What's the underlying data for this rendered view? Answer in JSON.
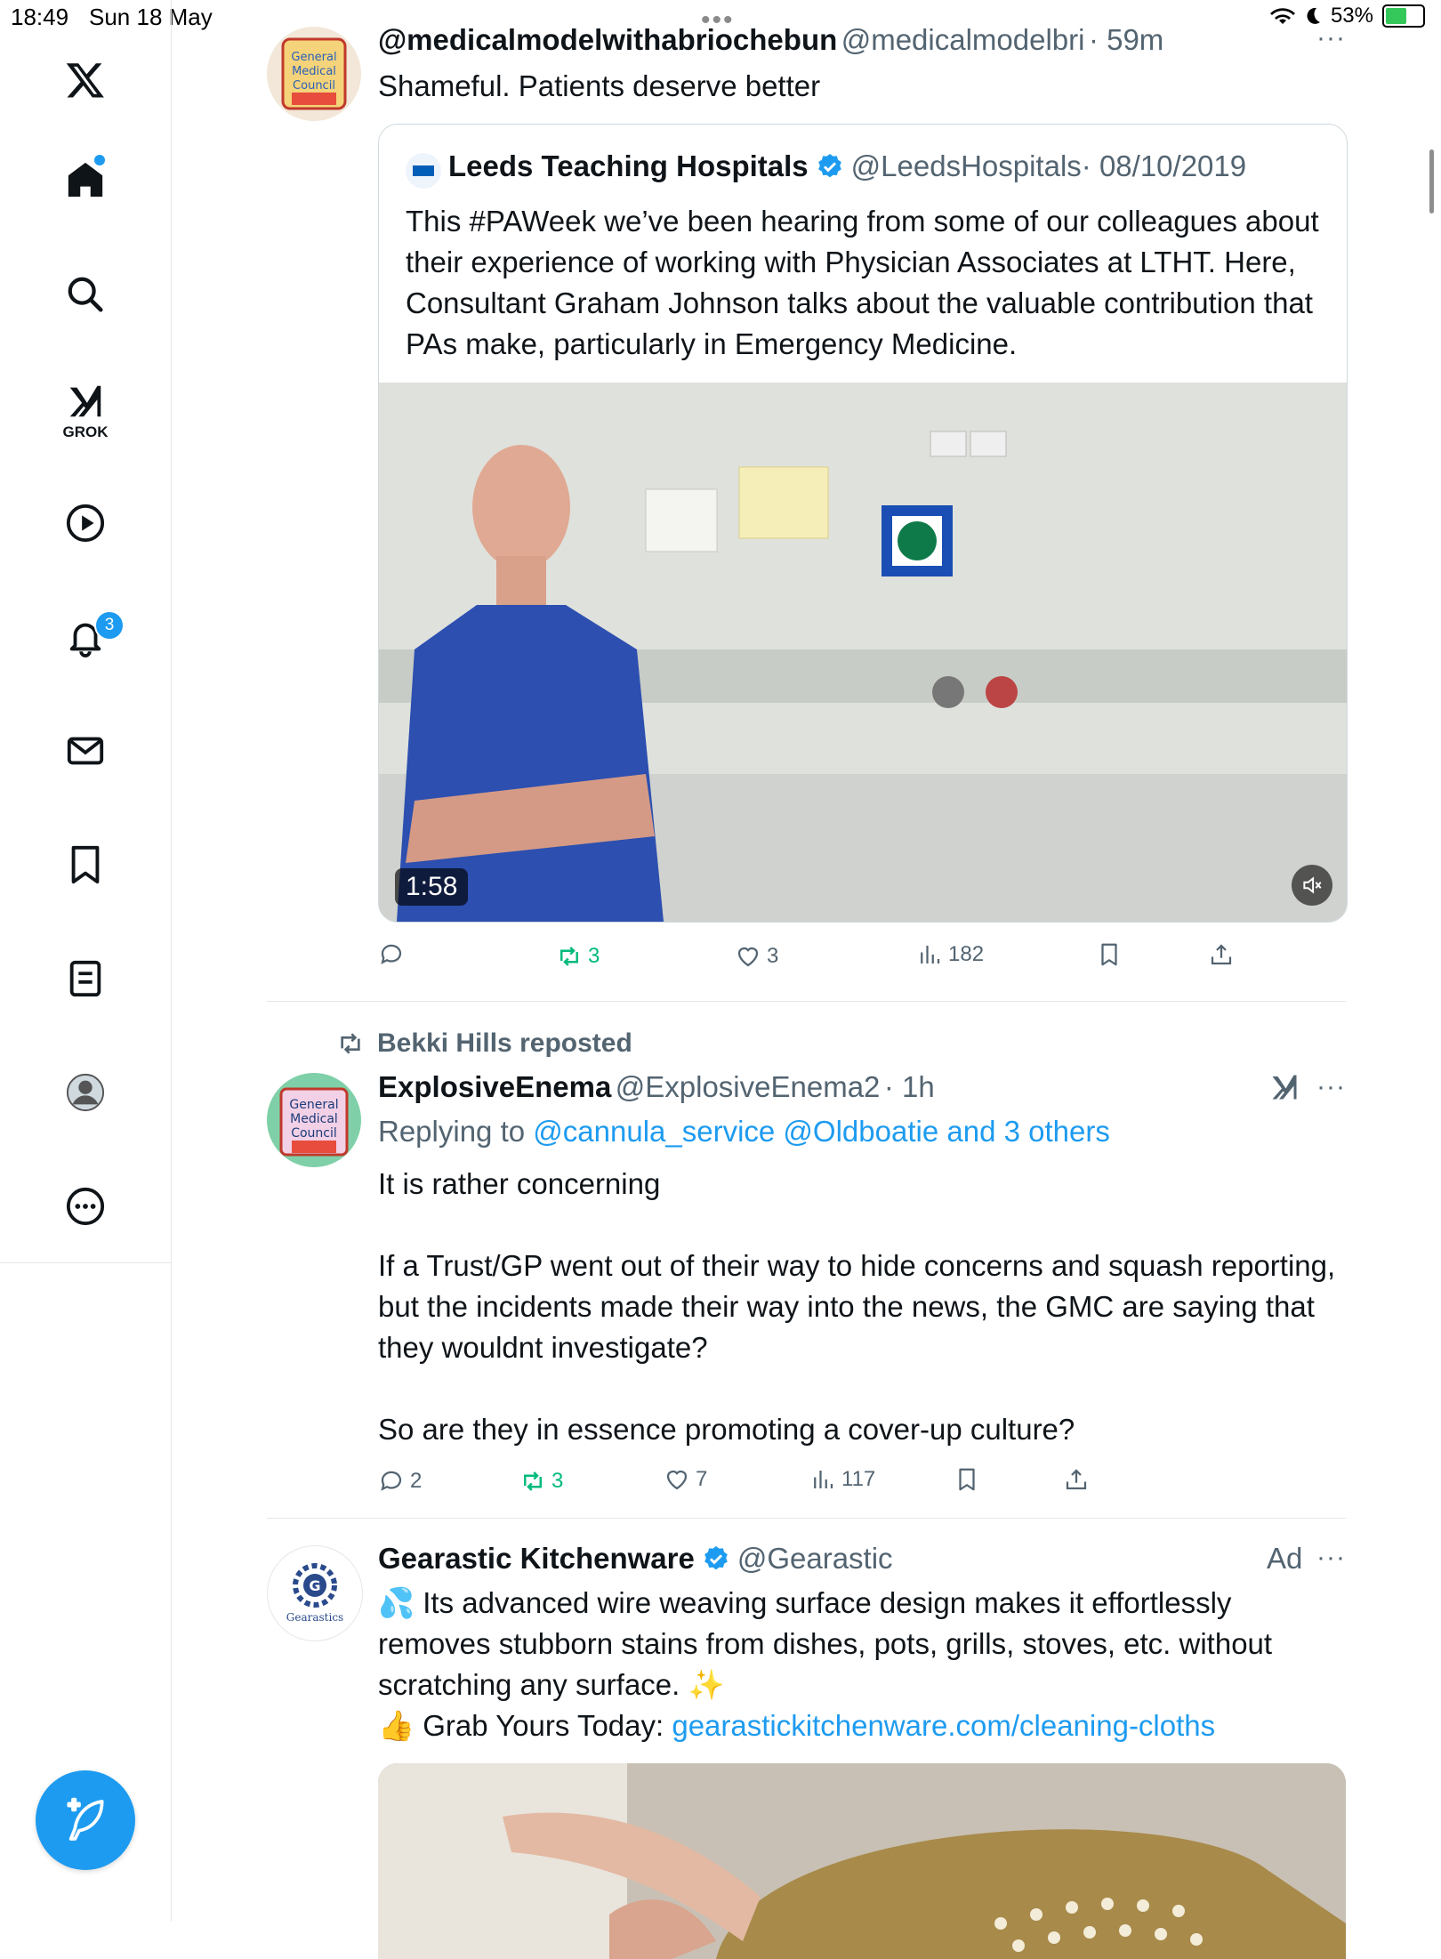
{
  "status_bar": {
    "time": "18:49",
    "date": "Sun 18 May",
    "battery": "53%",
    "battery_level": 0.53
  },
  "sidebar": {
    "grok_label": "GROK",
    "notifications_count": "3",
    "items": [
      "home-icon",
      "search-icon",
      "grok-icon",
      "video-icon",
      "bell-icon",
      "mail-icon",
      "bookmark-icon",
      "lists-icon",
      "profile-icon",
      "more-icon"
    ]
  },
  "tweet1": {
    "name": "@medicalmodelwithabriochebun",
    "handle": "@medicalmodelbri",
    "time": "· 59m",
    "text": "Shameful. Patients deserve better",
    "avatar_text": "General Medical Council",
    "quote": {
      "name": "Leeds Teaching Hospitals",
      "handle": "@LeedsHospitals",
      "date": "· 08/10/2019",
      "text": "This #PAWeek we’ve been hearing from some of our colleagues about their experience of working with Physician Associates at LTHT. Here, Consultant Graham Johnson talks about the valuable contribution that PAs make, particularly in Emergency Medicine.",
      "video_duration": "1:58"
    },
    "actions": {
      "replies": "",
      "reposts": "3",
      "likes": "3",
      "views": "182"
    }
  },
  "tweet2": {
    "reposted_by": "Bekki Hills reposted",
    "name": "ExplosiveEnema",
    "handle": "@ExplosiveEnema2",
    "time": "· 1h",
    "replying_prefix": "Replying to",
    "replying_to": "@cannula_service @Oldboatie and 3 others",
    "avatar_text": "General Medical Council",
    "para1": "It is rather concerning",
    "para2": "If a Trust/GP went out of their way to hide concerns and squash reporting, but the incidents made their way into the news, the GMC are saying that they wouldnt investigate?",
    "para3": "So are they in essence promoting a cover-up culture?",
    "actions": {
      "replies": "2",
      "reposts": "3",
      "likes": "7",
      "views": "117"
    }
  },
  "tweet3": {
    "name": "Gearastic Kitchenware",
    "handle": "@Gearastic",
    "ad_label": "Ad",
    "avatar_text": "Gearastics",
    "line1": "💦 Its advanced wire weaving surface design makes it effortlessly removes stubborn stains from dishes, pots, grills, stoves, etc. without scratching any surface. ✨",
    "line2_prefix": "👍 Grab Yours Today: ",
    "line2_link": "gearastickitchenware.com/cleaning-cloths"
  },
  "colors": {
    "accent": "#1d9bf0",
    "repost_green": "#00ba7c",
    "muted": "#536471",
    "text": "#0f1419"
  }
}
